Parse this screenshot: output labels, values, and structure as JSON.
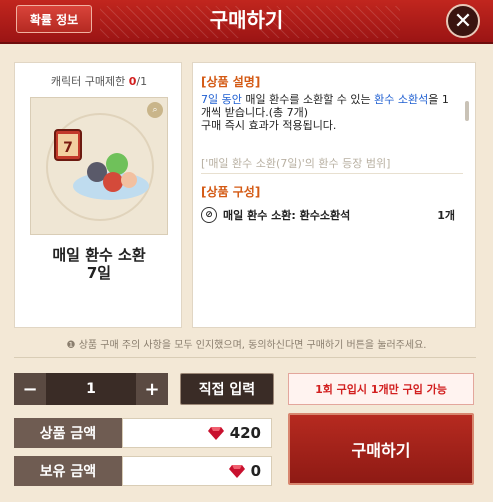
{
  "header": {
    "title": "구매하기",
    "prob_button": "확률 정보"
  },
  "left": {
    "limit_label": "캐릭터 구매제한",
    "limit_current": "0",
    "limit_total": "/1",
    "item_name_line1": "매일 환수 소환",
    "item_name_line2": "7일"
  },
  "right": {
    "desc_title": "[상품 설명]",
    "desc_p1": "7일 동안",
    "desc_p2": " 매일 환수를 소환할 수 있는 ",
    "desc_p3": "환수 소환석",
    "desc_p4": "을 1개씩 받습니다.(총 7개)",
    "desc_p5": "구매 즉시 효과가 적용됩니다.",
    "desc_faded": "['매일 환수 소환(7일)'의 환수 등장 범위]",
    "comp_title": "[상품 구성]",
    "comp_item": "매일 환수 소환: 환수소환석",
    "comp_qty": "1개"
  },
  "notice": "상품 구매 주의 사항을 모두 인지했으며, 동의하신다면 구매하기 버튼을 눌러주세요.",
  "controls": {
    "minus": "−",
    "quantity": "1",
    "plus": "+",
    "direct_input": "직접 입력",
    "purchase_limit": "1회 구입시 1개만 구입 가능",
    "price_label": "상품 금액",
    "price_value": "420",
    "balance_label": "보유 금액",
    "balance_value": "0",
    "buy_button": "구매하기"
  },
  "colors": {
    "accent": "#9b1414",
    "orange": "#d45a14",
    "blue": "#1f5fd1"
  }
}
